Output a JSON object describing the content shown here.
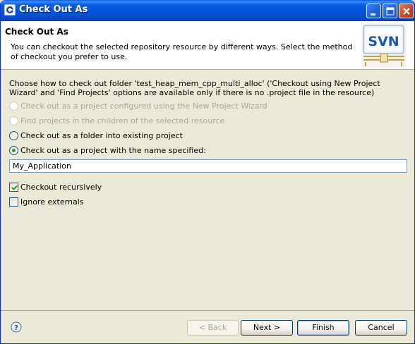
{
  "window": {
    "title": "Check Out As"
  },
  "header": {
    "title": "Check Out As",
    "description": "You can checkout the selected repository resource by different ways. Select the method of checkout you prefer to use.",
    "logo_text": "SVN"
  },
  "body": {
    "intro": "Choose how to check out folder 'test_heap_mem_cpp_multi_alloc' ('Checkout using New Project Wizard' and 'Find Projects' options are available only if there is no .project file in the resource)",
    "options": [
      {
        "label": "Check out as a project configured using the New Project Wizard",
        "enabled": false,
        "selected": false
      },
      {
        "label": "Find projects in the children of the selected resource",
        "enabled": false,
        "selected": false
      },
      {
        "label": "Check out as a folder into existing project",
        "enabled": true,
        "selected": false
      },
      {
        "label": "Check out as a project with the name specified:",
        "enabled": true,
        "selected": true
      }
    ],
    "project_name": "My_Application",
    "checkboxes": [
      {
        "label": "Checkout recursively",
        "checked": true
      },
      {
        "label": "Ignore externals",
        "checked": false
      }
    ]
  },
  "footer": {
    "back_label": "< Back",
    "next_label": "Next >",
    "finish_label": "Finish",
    "cancel_label": "Cancel"
  }
}
